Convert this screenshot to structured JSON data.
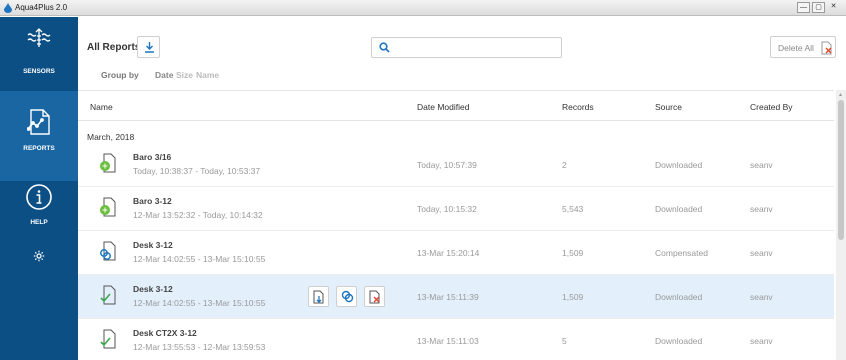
{
  "window": {
    "title": "Aqua4Plus 2.0",
    "minimize": "—",
    "maximize": "▢",
    "close": "✕"
  },
  "sidebar": {
    "items": [
      {
        "label": "SENSORS",
        "icon": "sensors-icon"
      },
      {
        "label": "REPORTS",
        "icon": "reports-icon",
        "active": true
      },
      {
        "label": "HELP",
        "icon": "help-icon"
      },
      {
        "label": "",
        "icon": "settings-gear-icon"
      }
    ]
  },
  "toolbar": {
    "title": "All Reports",
    "group_by_label": "Group by",
    "group_options": [
      "Date",
      "Size",
      "Name"
    ],
    "search_placeholder": "",
    "delete_all_label": "Delete All"
  },
  "table": {
    "headers": [
      "Name",
      "Date Modified",
      "Records",
      "Source",
      "Created By"
    ],
    "group": "March, 2018",
    "rows": [
      {
        "name": "Baro 3/16",
        "range": "Today, 10:38:37 - Today, 10:53:37",
        "modified": "Today, 10:57:39",
        "records": "2",
        "source": "Downloaded",
        "created_by": "seanv",
        "icon": "baro-report-icon"
      },
      {
        "name": "Baro 3-12",
        "range": "12-Mar 13:52:32 - Today, 10:14:32",
        "modified": "Today, 10:15:32",
        "records": "5,543",
        "source": "Downloaded",
        "created_by": "seanv",
        "icon": "baro-report-icon"
      },
      {
        "name": "Desk 3-12",
        "range": "12-Mar 14:02:55 - 13-Mar 15:10:55",
        "modified": "13-Mar 15:20:14",
        "records": "1,509",
        "source": "Compensated",
        "created_by": "seanv",
        "icon": "compensated-report-icon"
      },
      {
        "name": "Desk 3-12",
        "range": "12-Mar 14:02:55 - 13-Mar 15:10:55",
        "modified": "13-Mar 15:11:39",
        "records": "1,509",
        "source": "Downloaded",
        "created_by": "seanv",
        "icon": "downloaded-report-icon",
        "selected": true
      },
      {
        "name": "Desk CT2X 3-12",
        "range": "12-Mar 13:55:53 - 12-Mar 13:59:53",
        "modified": "13-Mar 15:11:03",
        "records": "5",
        "source": "Downloaded",
        "created_by": "seanv",
        "icon": "downloaded-report-icon"
      }
    ]
  },
  "colors": {
    "sidebar": "#0b4f85",
    "sidebar_active": "#1a66a3",
    "accent": "#1f75c0",
    "selected_row": "#e3f0fb",
    "delete_red": "#e0442c",
    "baro_green": "#6abf3d"
  }
}
